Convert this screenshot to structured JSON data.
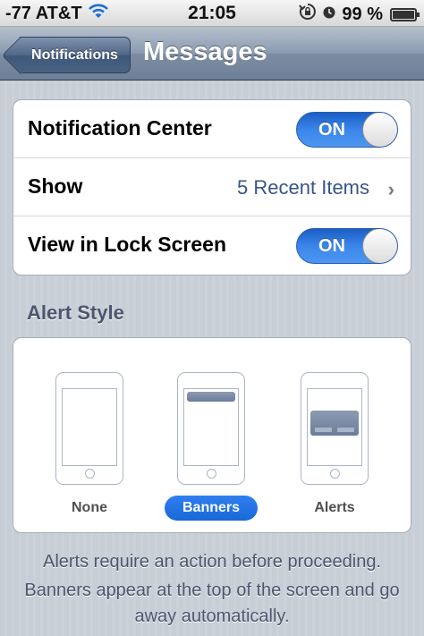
{
  "status_bar": {
    "carrier": "-77 AT&T",
    "time": "21:05",
    "battery_text": "99 %",
    "battery_level": 0.99,
    "icons": [
      "wifi-icon",
      "rotation-lock-icon",
      "alarm-icon",
      "battery-icon"
    ]
  },
  "nav": {
    "back_label": "Notifications",
    "title": "Messages"
  },
  "settings": {
    "notification_center": {
      "label": "Notification Center",
      "toggle": "ON"
    },
    "show": {
      "label": "Show",
      "value": "5 Recent Items",
      "chevron": "›"
    },
    "lock_screen": {
      "label": "View in Lock Screen",
      "toggle": "ON"
    }
  },
  "alert_style": {
    "header": "Alert Style",
    "options": [
      {
        "label": "None",
        "selected": false
      },
      {
        "label": "Banners",
        "selected": true
      },
      {
        "label": "Alerts",
        "selected": false
      }
    ]
  },
  "footer": {
    "line1": "Alerts require an action before proceeding.",
    "line2": "Banners appear at the top of the screen and go away automatically."
  },
  "colors": {
    "toggle_on": "#3b86ea",
    "value_text": "#385487",
    "selected_style": "#1868d8",
    "section_header": "#4c566c"
  }
}
